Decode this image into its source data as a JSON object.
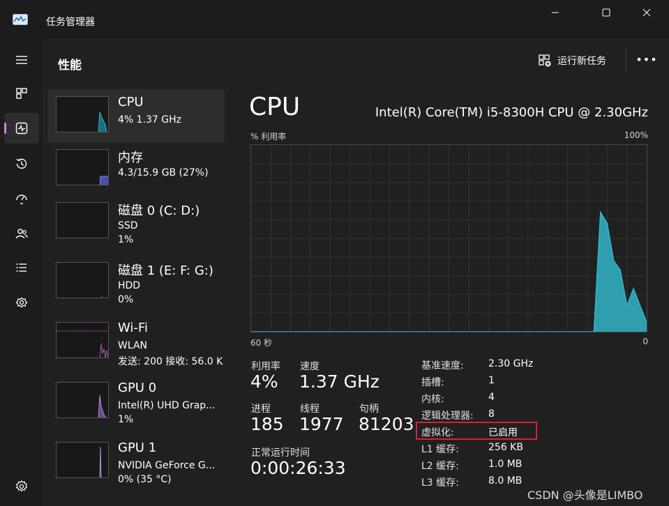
{
  "window": {
    "title": "任务管理器",
    "minimize_label": "—",
    "maximize_label": "☐",
    "close_label": "✕"
  },
  "rail": {
    "items": [
      {
        "icon": "hamburger-icon"
      },
      {
        "icon": "processes-icon"
      },
      {
        "icon": "performance-icon"
      },
      {
        "icon": "app-history-icon"
      },
      {
        "icon": "startup-icon"
      },
      {
        "icon": "users-icon"
      },
      {
        "icon": "details-icon"
      },
      {
        "icon": "services-icon"
      },
      {
        "icon": "settings-icon"
      }
    ],
    "active_index": 2,
    "accent_color": "#c489d0"
  },
  "header": {
    "page_title": "性能",
    "run_task_label": "运行新任务",
    "more_label": "•••"
  },
  "sidebar": {
    "items": [
      {
        "name": "CPU",
        "line1": "4% 1.37 GHz",
        "line2": "",
        "color": "#33b5c9",
        "active": true
      },
      {
        "name": "内存",
        "line1": "4.3/15.9 GB (27%)",
        "line2": "",
        "color": "#8a8ef2",
        "active": false
      },
      {
        "name": "磁盘 0 (C: D:)",
        "line1": "SSD",
        "line2": "1%",
        "color": "#55c28c",
        "active": false
      },
      {
        "name": "磁盘 1 (E: F: G:)",
        "line1": "HDD",
        "line2": "0%",
        "color": "#55c28c",
        "active": false
      },
      {
        "name": "Wi-Fi",
        "line1": "WLAN",
        "line2": "发送: 200 接收: 56.0 K",
        "color": "#d46bd9",
        "active": false
      },
      {
        "name": "GPU 0",
        "line1": "Intel(R) UHD Grap...",
        "line2": "1%",
        "color": "#b28fd9",
        "active": false
      },
      {
        "name": "GPU 1",
        "line1": "NVIDIA GeForce G...",
        "line2": "0% (35 °C)",
        "color": "#b28fd9",
        "active": false
      }
    ]
  },
  "detail": {
    "title": "CPU",
    "model": "Intel(R) Core(TM) i5-8300H CPU @ 2.30GHz",
    "graph_top_left": "% 利用率",
    "graph_top_right": "100%",
    "graph_bottom_left": "60 秒",
    "graph_bottom_right": "0",
    "graph_color": "#33b5c9",
    "stats": {
      "utilization_label": "利用率",
      "utilization_value": "4%",
      "speed_label": "速度",
      "speed_value": "1.37 GHz",
      "processes_label": "进程",
      "processes_value": "185",
      "threads_label": "线程",
      "threads_value": "1977",
      "handles_label": "句柄",
      "handles_value": "81203",
      "uptime_label": "正常运行时间",
      "uptime_value": "0:00:26:33"
    },
    "properties": [
      {
        "key": "基准速度:",
        "value": "2.30 GHz"
      },
      {
        "key": "插槽:",
        "value": "1"
      },
      {
        "key": "内核:",
        "value": "4"
      },
      {
        "key": "逻辑处理器:",
        "value": "8"
      },
      {
        "key": "虚拟化:",
        "value": "已启用"
      },
      {
        "key": "L1 缓存:",
        "value": "256 KB"
      },
      {
        "key": "L2 缓存:",
        "value": "1.0 MB"
      },
      {
        "key": "L3 缓存:",
        "value": "8.0 MB"
      }
    ],
    "highlight_color": "#d9232a"
  },
  "chart_data": {
    "type": "area",
    "x": [
      60,
      50,
      40,
      30,
      20,
      10,
      8,
      7,
      6,
      5,
      4,
      3,
      2,
      1,
      0
    ],
    "values": [
      0,
      0,
      0,
      0,
      0,
      0,
      0,
      64,
      58,
      38,
      33,
      14,
      23,
      14,
      5
    ],
    "xlabel": "60 秒",
    "ylabel": "% 利用率",
    "ylim": [
      0,
      100
    ],
    "grid": true
  },
  "watermark": "CSDN @头像是LIMBO"
}
